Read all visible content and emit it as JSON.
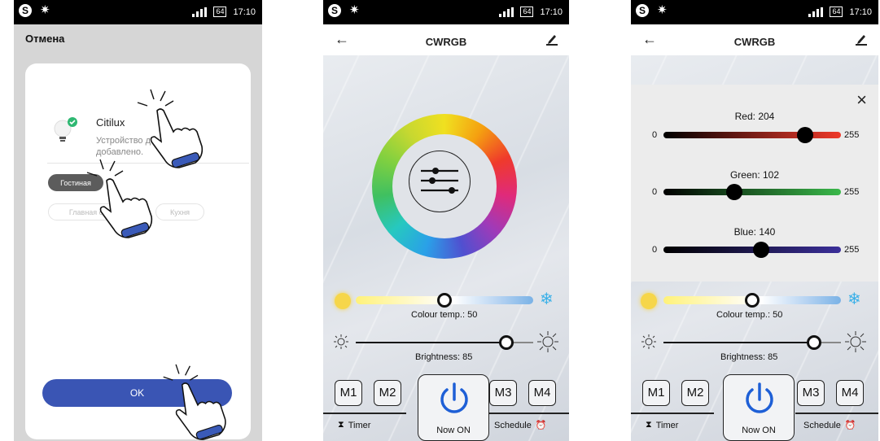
{
  "status_bar": {
    "time": "17:10",
    "battery": "64"
  },
  "screen1": {
    "cancel_label": "Отмена",
    "device_name": "Citilux",
    "device_status": "Устройство д добавлено.",
    "rooms": [
      "Гостиная",
      "Главная сп",
      "Кухня"
    ],
    "active_room": "Гостиная",
    "ok_label": "OK"
  },
  "screen2": {
    "title": "CWRGB",
    "colour_temp_label": "Colour temp.: 50",
    "colour_temp": 50,
    "brightness_label": "Brightness: 85",
    "brightness": 85,
    "memory_buttons": [
      "M1",
      "M2",
      "M3",
      "M4"
    ],
    "power_label": "Now ON",
    "timer_label": "Timer",
    "schedule_label": "Schedule"
  },
  "screen3": {
    "title": "CWRGB",
    "sliders": [
      {
        "label": "Red: 204",
        "value": 204,
        "min": "0",
        "max": "255"
      },
      {
        "label": "Green: 102",
        "value": 102,
        "min": "0",
        "max": "255"
      },
      {
        "label": "Blue: 140",
        "value": 140,
        "min": "0",
        "max": "255"
      }
    ],
    "colour_temp_label": "Colour temp.: 50",
    "colour_temp": 50,
    "brightness_label": "Brightness: 85",
    "brightness": 85,
    "memory_buttons": [
      "M1",
      "M2",
      "M3",
      "M4"
    ],
    "power_label": "Now ON",
    "timer_label": "Timer",
    "schedule_label": "Schedule"
  },
  "icons": [
    "skype-icon",
    "sun-icon",
    "signal-icon",
    "battery-icon",
    "back-arrow-icon",
    "edit-icon",
    "bulb-icon",
    "check-icon",
    "hand-pointer-icon",
    "equalizer-icon",
    "snowflake-icon",
    "brightness-low-icon",
    "brightness-high-icon",
    "power-icon",
    "hourglass-icon",
    "alarm-clock-icon",
    "close-icon"
  ],
  "colors": {
    "accent_blue": "#3a55b4",
    "check_green": "#2eb872",
    "snow_blue": "#3ab0e8",
    "sun_yellow": "#f6d64a"
  }
}
